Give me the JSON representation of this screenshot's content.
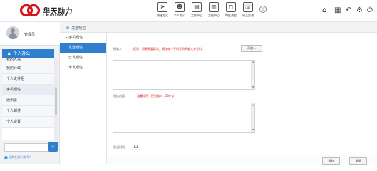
{
  "brand": {
    "name_cn": "华天动力",
    "name_en": "CNPOWER"
  },
  "modules": [
    {
      "label": "快捷方式",
      "icon": "send-icon"
    },
    {
      "label": "个人办公",
      "icon": "person-icon"
    },
    {
      "label": "工作中心",
      "icon": "briefcase-icon"
    },
    {
      "label": "文档中心",
      "icon": "document-icon"
    },
    {
      "label": "审批流程",
      "icon": "flow-icon"
    },
    {
      "label": "网上交流",
      "icon": "chat-icon"
    }
  ],
  "sidebar": {
    "username": "管理员",
    "section_title": "个人办公",
    "items": [
      "我的人事",
      "我的行政",
      "个人文件柜",
      "手机短信",
      "通讯录",
      "个人邮件",
      "个人设置"
    ],
    "online_text": "当前在线人数:1人"
  },
  "breadcrumb": "发送短信",
  "subnav": {
    "header": "手机短信",
    "items": [
      "发送短信",
      "已发短信",
      "未发短信"
    ]
  },
  "form": {
    "recipient_label": "接收人",
    "recipient_hint": "提示：如果需要群发，请在每个手机号码间输入分号(;)",
    "add_button": "添加...",
    "content_label": "短信内容",
    "content_hint": "温馨提示：还可输入：200 字",
    "send_time_label": "发送时间"
  },
  "actions": {
    "save": "保存",
    "send": "发送"
  }
}
